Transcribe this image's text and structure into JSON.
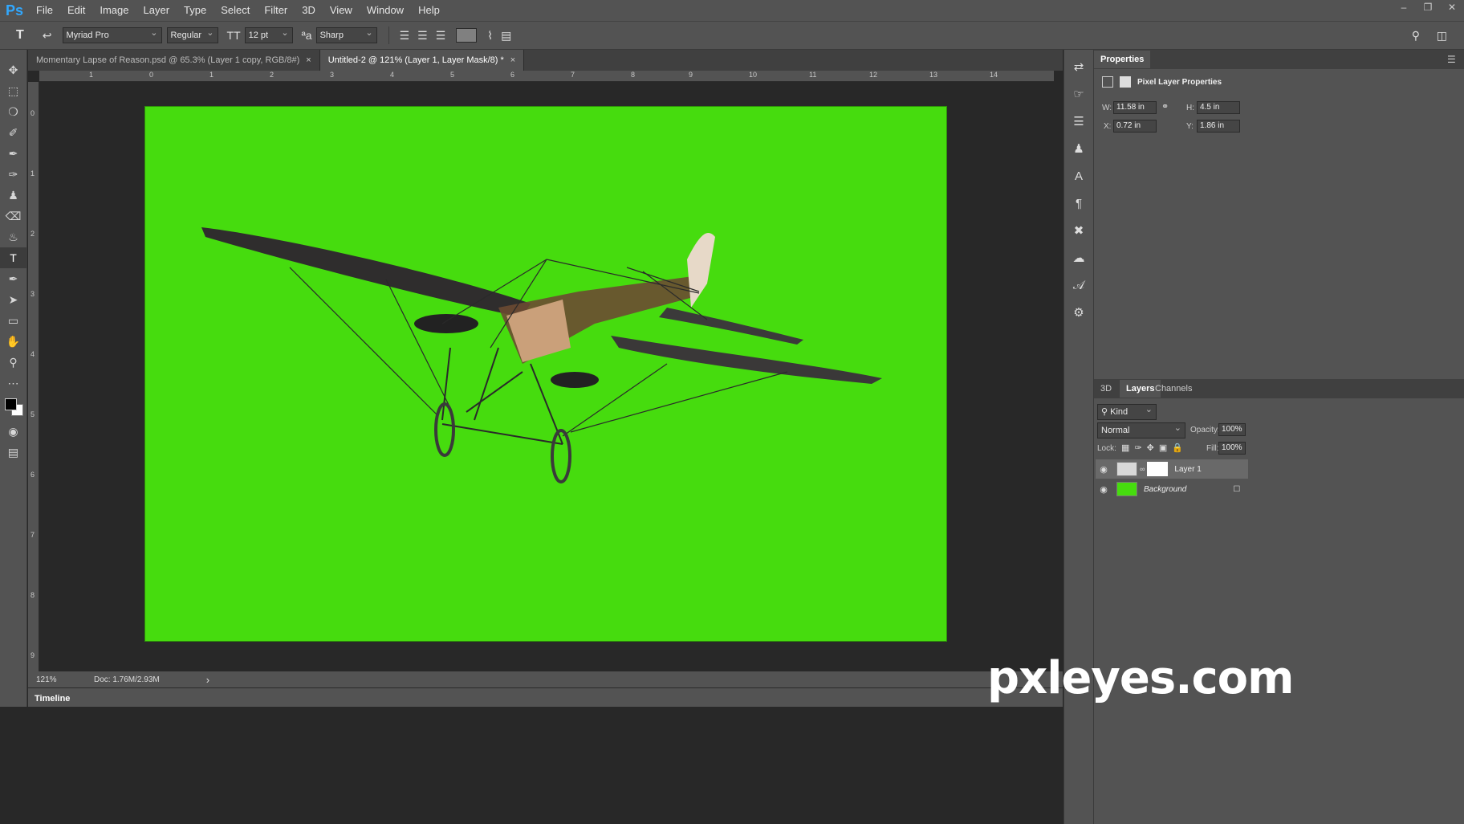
{
  "app": {
    "logo": "Ps"
  },
  "menu": [
    "File",
    "Edit",
    "Image",
    "Layer",
    "Type",
    "Select",
    "Filter",
    "3D",
    "View",
    "Window",
    "Help"
  ],
  "window_controls": {
    "minimize": "–",
    "restore": "❐",
    "close": "✕"
  },
  "options": {
    "font_family": "Myriad Pro",
    "font_style": "Regular",
    "font_size": "12 pt",
    "aa_label": "ªa",
    "antialias": "Sharp"
  },
  "tabs": [
    {
      "label": "Momentary Lapse of Reason.psd @ 65.3% (Layer 1 copy, RGB/8#)",
      "close": "×"
    },
    {
      "label": "Untitled-2 @ 121% (Layer 1, Layer Mask/8) *",
      "close": "×"
    }
  ],
  "ruler_h": [
    "1",
    "0",
    "1",
    "2",
    "3",
    "4",
    "5",
    "6",
    "7",
    "8",
    "9",
    "10",
    "11",
    "12",
    "13",
    "14"
  ],
  "ruler_v": [
    "0",
    "1",
    "2",
    "3",
    "4",
    "5",
    "6",
    "7",
    "8",
    "9"
  ],
  "status": {
    "zoom": "121%",
    "doc": "Doc: 1.76M/2.93M",
    "arrow": "›"
  },
  "timeline": {
    "label": "Timeline"
  },
  "properties": {
    "tab": "Properties",
    "subtitle": "Pixel Layer Properties",
    "w_label": "W:",
    "w": "11.58 in",
    "h_label": "H:",
    "h": "4.5 in",
    "x_label": "X:",
    "x": "0.72 in",
    "y_label": "Y:",
    "y": "1.86 in"
  },
  "layers_panel": {
    "tabs": [
      "3D",
      "Layers",
      "Channels"
    ],
    "filter": "Kind",
    "blend_mode": "Normal",
    "opacity_label": "Opacity:",
    "opacity": "100%",
    "lock_label": "Lock:",
    "fill_label": "Fill:",
    "fill": "100%",
    "layers": [
      {
        "name": "Layer 1"
      },
      {
        "name": "Background"
      }
    ]
  },
  "canvas": {
    "color": "#46dc0e"
  },
  "watermark": "pxleyes.com"
}
